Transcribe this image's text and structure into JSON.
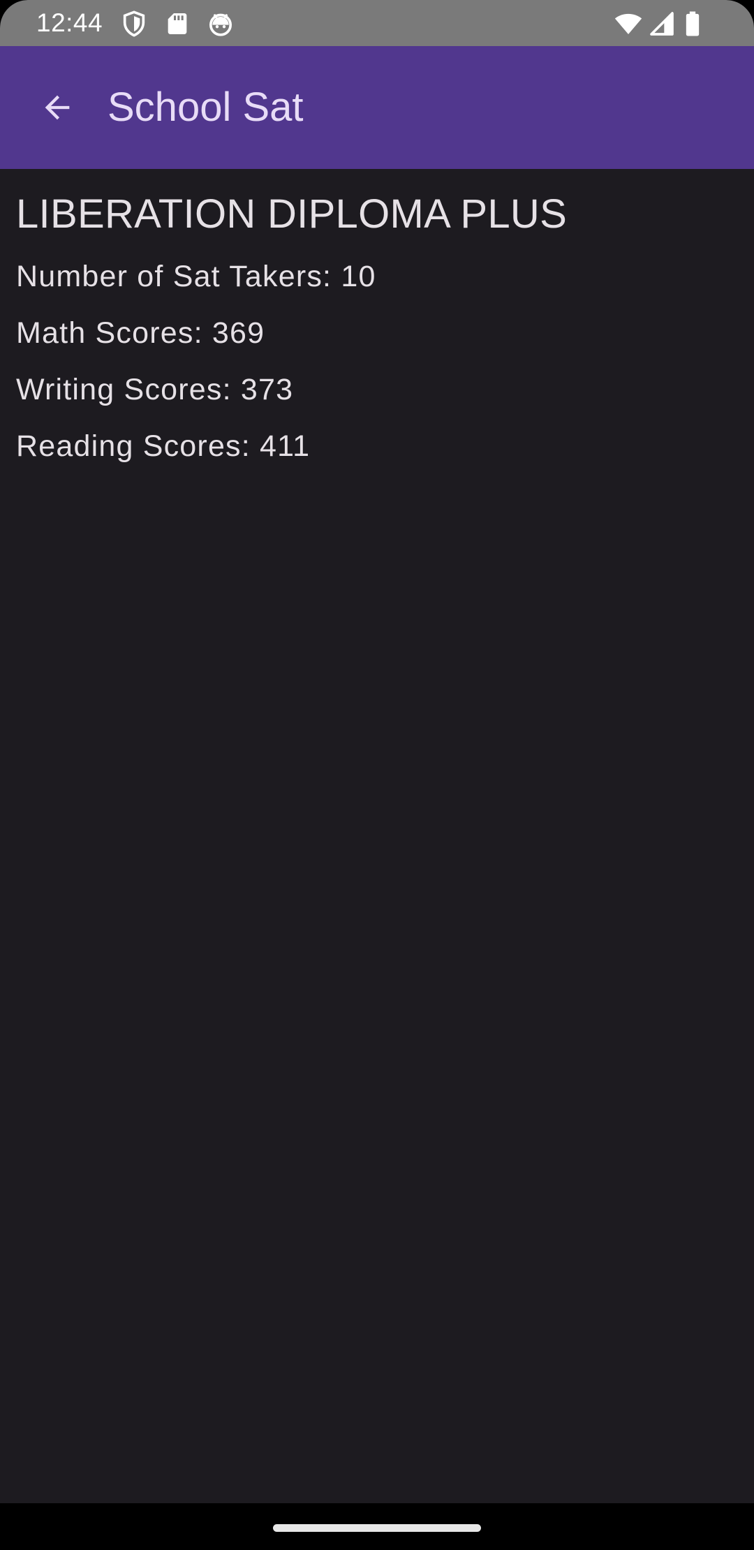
{
  "status_bar": {
    "time": "12:44",
    "icons_left": [
      "shield-icon",
      "sd-card-icon",
      "android-head-icon"
    ],
    "icons_right": [
      "wifi-icon",
      "signal-icon",
      "battery-icon"
    ]
  },
  "app_bar": {
    "title": "School Sat",
    "back_icon": "arrow-back-icon",
    "background_color": "#51378e"
  },
  "school": {
    "name": "LIBERATION DIPLOMA PLUS",
    "stats": [
      "Number of Sat Takers: 10",
      "Math Scores: 369",
      "Writing Scores: 373",
      "Reading Scores: 411"
    ]
  },
  "colors": {
    "background": "#1d1b20",
    "text": "#e6e1e6",
    "status_bar": "#7a7a7a"
  }
}
